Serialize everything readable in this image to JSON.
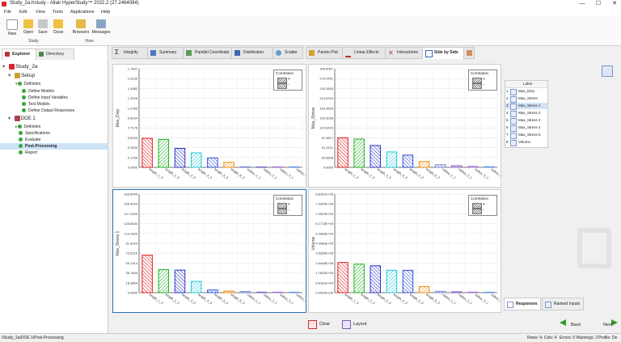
{
  "window": {
    "title": "Study_2a.hstudy - Altair HyperStudy™ 2022.2 (27.2464084)",
    "minimize": "—",
    "maximize": "☐",
    "close": "✕"
  },
  "menu": [
    "File",
    "Edit",
    "View",
    "Tools",
    "Applications",
    "Help"
  ],
  "ribbon": {
    "buttons": [
      "New",
      "Open",
      "Save",
      "Close",
      "Browsers",
      "Messages"
    ],
    "groups": [
      "Study",
      "View"
    ]
  },
  "left": {
    "tabs": [
      "Explorer",
      "Directory"
    ],
    "tree": [
      {
        "label": "Study_2a",
        "level": 0
      },
      {
        "label": "Setup",
        "level": 1
      },
      {
        "label": "Definition",
        "level": 2
      },
      {
        "label": "Define Models",
        "level": 3
      },
      {
        "label": "Define Input Variables",
        "level": 3
      },
      {
        "label": "Test Models",
        "level": 3
      },
      {
        "label": "Define Output Responses",
        "level": 3
      },
      {
        "label": "DOE 1",
        "level": 1
      },
      {
        "label": "Definition",
        "level": 2
      },
      {
        "label": "Specifications",
        "level": 2
      },
      {
        "label": "Evaluate",
        "level": 2
      },
      {
        "label": "Post-Processing",
        "level": 2
      },
      {
        "label": "Report",
        "level": 2
      }
    ]
  },
  "tabs": [
    "Integrity",
    "Summary",
    "Parallel Coordinate",
    "Distribution",
    "Scatter",
    "Pareto Plot",
    "Linear Effects",
    "Interactions",
    "Side by Side"
  ],
  "legend": {
    "title": "Correlation",
    "pos": "+",
    "neg": "-"
  },
  "chart_data": [
    {
      "type": "bar",
      "ylabel": "Max_Disp",
      "categories": [
        "length_1_3",
        "length_2_3",
        "length_3_3",
        "length_4_3",
        "length_5_3",
        "length_6_3",
        "radius_1_1",
        "radius_2_1",
        "radius_3_1",
        "radius_4_1"
      ],
      "yticks": [
        "1.7647",
        "1.6139",
        "1.4582",
        "1.2628",
        "1.0786",
        "0.8934",
        "0.7176",
        "0.5294",
        "0.3530",
        "0.1766",
        "0.0000"
      ],
      "ylim": [
        0,
        1.7647
      ],
      "values": [
        0.52,
        0.5,
        0.34,
        0.26,
        0.17,
        0.09,
        0.01,
        0.005,
        0.003,
        0.002
      ],
      "signs": [
        "+",
        "-",
        "+",
        "-",
        "+",
        "-",
        "+",
        "-",
        "+",
        "-"
      ],
      "legend_position": "top-right"
    },
    {
      "type": "bar",
      "ylabel": "Max_Stress",
      "categories": [
        "length_1_3",
        "length_2_3",
        "length_3_3",
        "length_4_3",
        "length_5_3",
        "length_6_3",
        "radius_1_1",
        "radius_2_1",
        "radius_3_1",
        "radius_4_1"
      ],
      "yticks": [
        "306.6057",
        "275.9451",
        "245.2845",
        "214.6240",
        "183.9634",
        "153.3028",
        "122.6423",
        "91.9817",
        "61.3211",
        "30.6606",
        "0.0000"
      ],
      "ylim": [
        0,
        306.6057
      ],
      "values": [
        92,
        88,
        68,
        48,
        38,
        18,
        8,
        5,
        3,
        2
      ],
      "signs": [
        "+",
        "-",
        "+",
        "-",
        "+",
        "-",
        "+",
        "-",
        "+",
        "-"
      ],
      "legend_position": "top-right"
    },
    {
      "type": "bar",
      "ylabel": "Max_Stress 1",
      "categories": [
        "length_1_3",
        "length_2_3",
        "length_3_3",
        "length_4_3",
        "length_5_3",
        "length_6_3",
        "radius_1_1",
        "radius_2_1",
        "radius_3_1",
        "radius_4_1"
      ],
      "yticks": [
        "183.8049",
        "165.4244",
        "147.0439",
        "128.6634",
        "110.2829",
        "91.9024",
        "73.5219",
        "55.1414",
        "36.7609",
        "18.3804",
        "0.0000"
      ],
      "ylim": [
        0,
        183.8049
      ],
      "values": [
        70,
        43,
        42,
        21,
        5,
        3,
        2,
        1,
        1,
        0.5
      ],
      "signs": [
        "+",
        "-",
        "+",
        "-",
        "+",
        "-",
        "+",
        "-",
        "+",
        "-"
      ],
      "legend_position": "top-right"
    },
    {
      "type": "bar",
      "ylabel": "Volume",
      "categories": [
        "length_1_3",
        "length_2_3",
        "length_3_3",
        "length_4_3",
        "length_5_3",
        "length_6_3",
        "radius_1_1",
        "radius_2_1",
        "radius_3_1",
        "radius_4_1"
      ],
      "yticks": [
        "8.8161E+05",
        "7.9345E+05",
        "7.0529E+05",
        "6.1713E+05",
        "5.2896E+05",
        "4.4080E+05",
        "3.5264E+05",
        "2.6448E+05",
        "1.7632E+05",
        "8.8161E+04",
        "0.0000E+00"
      ],
      "ylim": [
        0,
        881610
      ],
      "values": [
        270000,
        255000,
        240000,
        200000,
        200000,
        55000,
        12000,
        8000,
        5000,
        3000
      ],
      "signs": [
        "+",
        "-",
        "+",
        "-",
        "+",
        "-",
        "+",
        "-",
        "+",
        "-"
      ],
      "legend_position": "top-right"
    }
  ],
  "responses": {
    "header": "Label",
    "rows": [
      {
        "n": "1",
        "label": "Max_Disp"
      },
      {
        "n": "2",
        "label": "Max_Stress"
      },
      {
        "n": "3",
        "label": "Max_Stress 1"
      },
      {
        "n": "4",
        "label": "Max_Stress 2"
      },
      {
        "n": "5",
        "label": "Max_Stress 3"
      },
      {
        "n": "6",
        "label": "Max_Stress 4"
      },
      {
        "n": "7",
        "label": "Max_Stress 5"
      },
      {
        "n": "8",
        "label": "Volume"
      }
    ],
    "tabs": [
      "Responses",
      "Ranked Inputs"
    ]
  },
  "bottom": {
    "clear": "Clear",
    "layout": "Layout",
    "back": "Back",
    "next": "Next"
  },
  "status": {
    "path": "/Study_2a/DOE 1/Post-Processing",
    "rows": "Rows: 4, Cols: 4",
    "errors": "Errors: 0  Warnings: 2",
    "profile": "Profile: De"
  },
  "colors": {
    "accent": "#2b73b7",
    "bars": [
      "#e02020",
      "#22b024",
      "#2a33c8",
      "#20c8d8",
      "#3050d8",
      "#f08c10",
      "#7080d0",
      "#8060c0",
      "#a070d0",
      "#6090e0"
    ]
  }
}
